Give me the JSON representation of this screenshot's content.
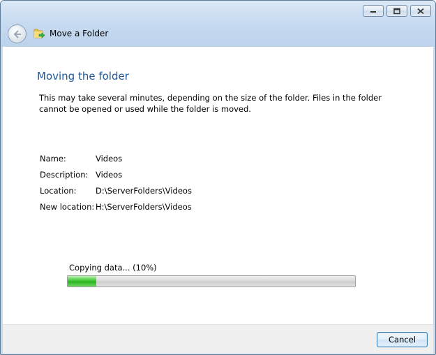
{
  "window": {
    "title": "Move a Folder",
    "caption_buttons": [
      "minimize-icon",
      "maximize-icon",
      "close-icon"
    ]
  },
  "page": {
    "heading": "Moving the folder",
    "description": "This may take several minutes, depending on the size of the folder. Files in the folder cannot be opened or used while the folder is moved."
  },
  "details": [
    {
      "label": "Name:",
      "value": "Videos"
    },
    {
      "label": "Description:",
      "value": "Videos"
    },
    {
      "label": "Location:",
      "value": "D:\\ServerFolders\\Videos"
    },
    {
      "label": "New location:",
      "value": "H:\\ServerFolders\\Videos"
    }
  ],
  "progress": {
    "label": "Copying data... (10%)",
    "fraction": 0.1
  },
  "footer": {
    "cancel_label": "Cancel"
  },
  "colors": {
    "heading": "#1e5aa0",
    "progress_fill": "#2bb520"
  }
}
